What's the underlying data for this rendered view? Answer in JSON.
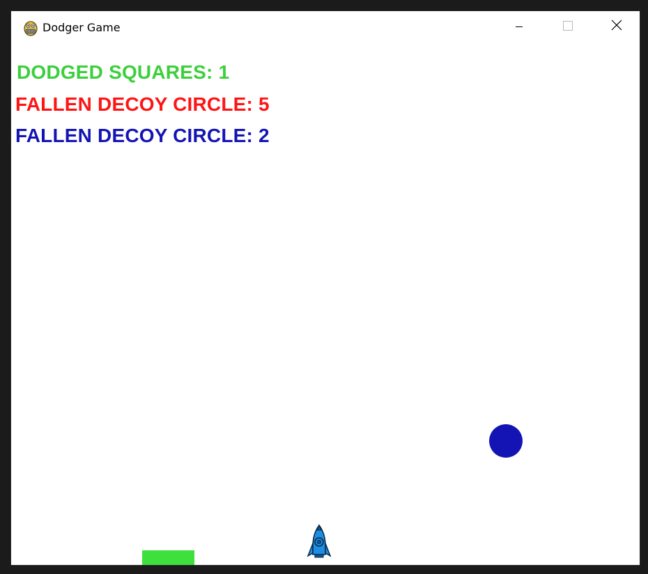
{
  "window": {
    "title": "Dodger Game",
    "app_icon": "pygame-snake-icon",
    "controls": {
      "minimize": "minimize-icon",
      "maximize": "maximize-icon",
      "close": "close-icon"
    }
  },
  "hud": {
    "dodged_squares": "DODGED SQUARES: 1",
    "fallen_red_circles": "FALLEN DECOY CIRCLE: 5",
    "fallen_blue_circles": "FALLEN DECOY CIRCLE: 2"
  },
  "colors": {
    "green": "#3ccf3c",
    "red": "#ff1414",
    "blue": "#1414b4",
    "player_blue": "#1e8fe0",
    "square_green": "#3ee03e",
    "background": "#ffffff"
  },
  "game_objects": {
    "blue_circle": "blue-decoy-circle",
    "green_square": "green-square",
    "player": "rocket-ship-icon"
  }
}
